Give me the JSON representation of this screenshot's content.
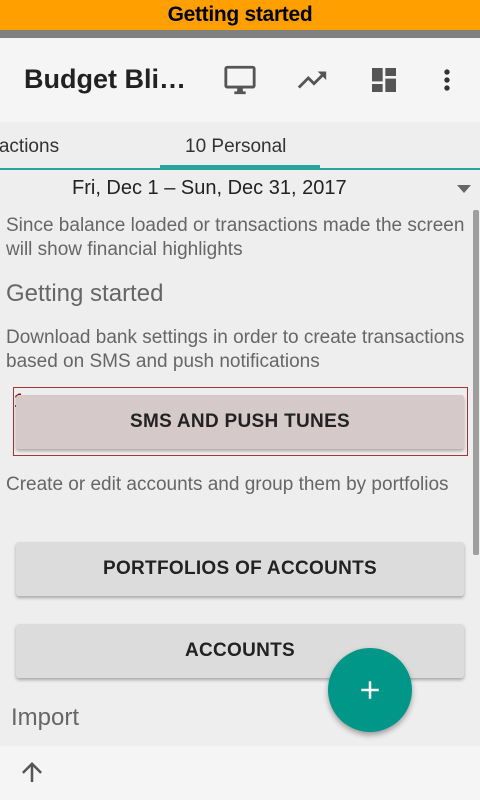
{
  "banner": {
    "text": "Getting started"
  },
  "toolbar": {
    "title": "Budget Bli…",
    "icons": [
      "monitor-icon",
      "trending-up-icon",
      "dashboard-icon",
      "more-vert-icon"
    ]
  },
  "tabs": [
    {
      "label": "Transactions"
    },
    {
      "label": "10 Personal"
    }
  ],
  "date_range": {
    "label": "Fri, Dec 1 – Sun, Dec 31, 2017"
  },
  "content": {
    "intro": "Since balance loaded or transactions made the screen will show financial highlights",
    "getting_started": "Getting started",
    "bank_desc": "Download bank settings in order to create transactions based on SMS and push notifications",
    "highlight_number": "1",
    "sms_button": "SMS AND PUSH TUNES",
    "accounts_desc": "Create or edit accounts and group them by portfolios",
    "portfolios_button": "PORTFOLIOS OF ACCOUNTS",
    "accounts_button": "ACCOUNTS",
    "import_title": "Import"
  },
  "fab": {
    "icon": "plus-icon"
  },
  "bottom": {
    "icon": "arrow-up-icon"
  },
  "colors": {
    "accent": "#009688",
    "banner": "#ffa000",
    "highlight": "#a33333"
  }
}
